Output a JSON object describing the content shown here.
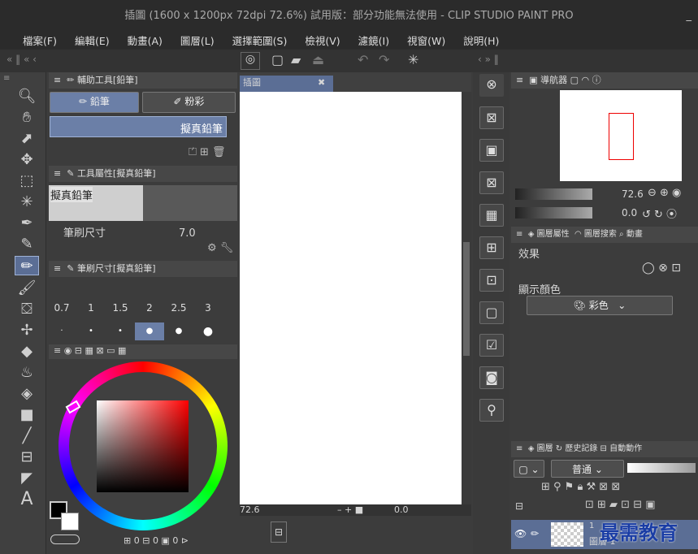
{
  "window": {
    "title": "插圖 (1600 x 1200px 72dpi 72.6%)  試用版：部分功能無法使用 - CLIP STUDIO PAINT PRO",
    "min_btn": "_"
  },
  "menu": [
    "檔案(F)",
    "編輯(E)",
    "動畫(A)",
    "圖層(L)",
    "選擇範圍(S)",
    "檢視(V)",
    "濾鏡(I)",
    "視窗(W)",
    "說明(H)"
  ],
  "subtool": {
    "header": "輔助工具[鉛筆]",
    "tabs": [
      "鉛筆",
      "粉彩"
    ],
    "current": "擬真鉛筆"
  },
  "toolprop": {
    "header": "工具屬性[擬真鉛筆]",
    "name": "擬真鉛筆",
    "brush_label": "筆刷尺寸",
    "brush_value": "7.0"
  },
  "brushsize": {
    "header": "筆刷尺寸[擬真鉛筆]",
    "sizes": [
      "0.7",
      "1",
      "1.5",
      "2",
      "2.5",
      "3"
    ],
    "selected": "2"
  },
  "canvas": {
    "tab": "插圖",
    "zoom": "72.6",
    "angle": "0.0"
  },
  "navigator": {
    "tab": "導航器",
    "zoom": "72.6",
    "angle": "0.0"
  },
  "layerprop": {
    "tab1": "圖層屬性",
    "tab2": "圖層搜索",
    "tab3": "動畫",
    "effect": "效果",
    "display_color": "顯示顏色",
    "color_mode": "彩色"
  },
  "layer": {
    "tab1": "圖層",
    "tab2": "歷史記錄",
    "tab3": "自動動作",
    "blend": "普通",
    "layer_name": "圖層 1",
    "layer_pct": "1"
  },
  "colorwheel": {
    "h_value": "0",
    "s_value": "0",
    "v_value": "0"
  },
  "watermark": "最需教育",
  "colors": {
    "accent": "#5b6e95",
    "main": "#000000",
    "sub": "#ffffff"
  }
}
